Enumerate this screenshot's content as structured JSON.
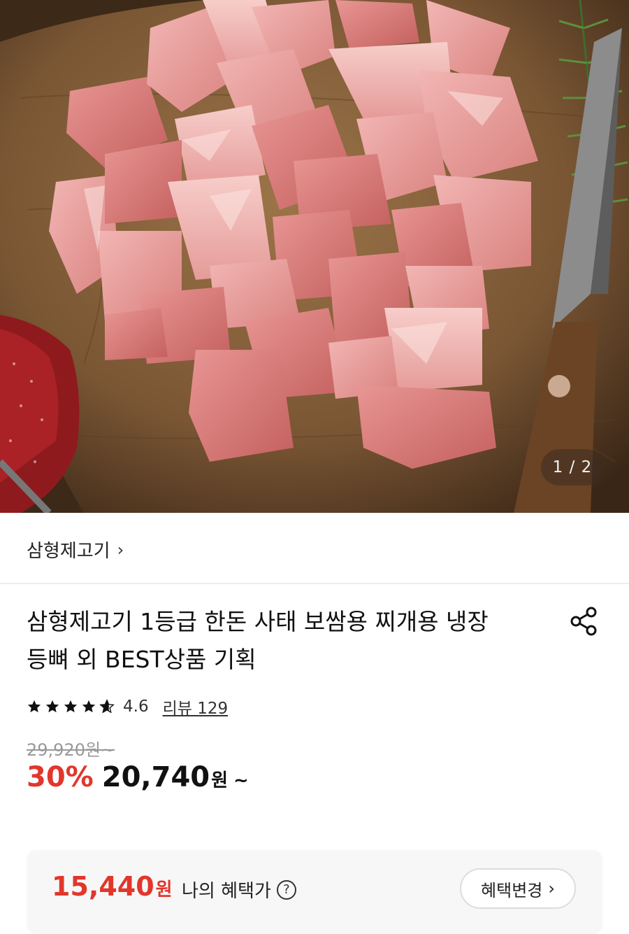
{
  "gallery": {
    "counter": "1 / 2",
    "alt": "product-photo"
  },
  "store": {
    "name": "삼형제고기",
    "chevron": "›"
  },
  "product": {
    "title_line1": "삼형제고기 1등급 한돈 사태 보쌈용 찌개용 냉장",
    "title_line2": "등뼈 외 BEST상품 기획"
  },
  "rating": {
    "stars": 4.6,
    "value": "4.6",
    "review_label": "리뷰 129"
  },
  "price": {
    "original": "29,920원~",
    "discount": "30%",
    "sale": "20,740",
    "won": "원",
    "tilde": "~"
  },
  "benefit": {
    "price": "15,440",
    "won": "원",
    "label": "나의 혜택가",
    "help": "?",
    "button": "혜택변경",
    "button_chevron": "›"
  },
  "colors": {
    "accent": "#e2362b",
    "text": "#111111",
    "card_bg": "#f7f7f7"
  },
  "icons": [
    "share-icon",
    "star-icon",
    "question-circle-icon",
    "chevron-right-icon"
  ]
}
